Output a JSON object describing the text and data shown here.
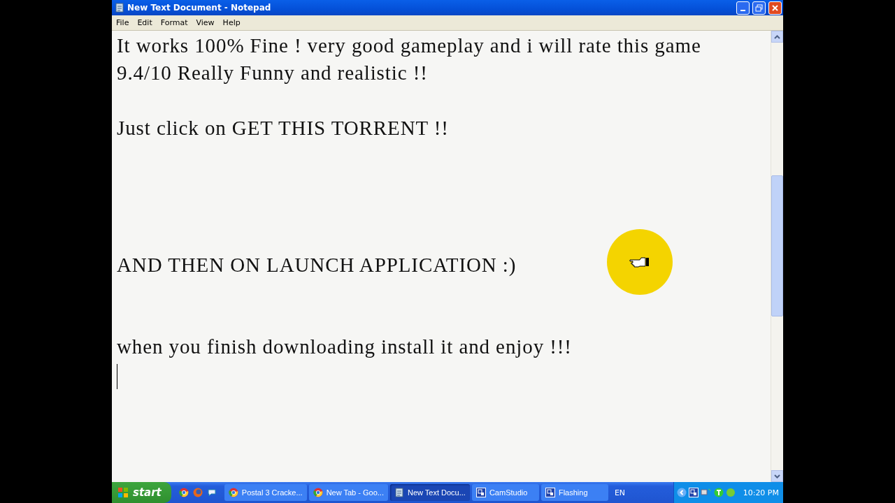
{
  "window": {
    "title": "New Text Document - Notepad"
  },
  "menu": [
    "File",
    "Edit",
    "Format",
    "View",
    "Help"
  ],
  "document": {
    "text": "It works 100% Fine ! very good gameplay and i will rate this game 9.4/10 Really Funny and realistic !!\n\nJust click on GET THIS TORRENT !!\n\n\n\n\nAND THEN ON LAUNCH APPLICATION :)\n\n\nwhen you finish downloading install it and enjoy !!!\n"
  },
  "taskbar": {
    "start": "start",
    "tasks": [
      {
        "label": "Postal 3 Cracke...",
        "kind": "browser",
        "selected": false
      },
      {
        "label": "New Tab - Goo...",
        "kind": "browser",
        "selected": false
      },
      {
        "label": "New Text Docu...",
        "kind": "notepad",
        "selected": true
      },
      {
        "label": "CamStudio",
        "kind": "app",
        "selected": false
      },
      {
        "label": "Flashing",
        "kind": "app",
        "selected": false
      }
    ],
    "language": "EN",
    "clock": "10:20 PM"
  }
}
